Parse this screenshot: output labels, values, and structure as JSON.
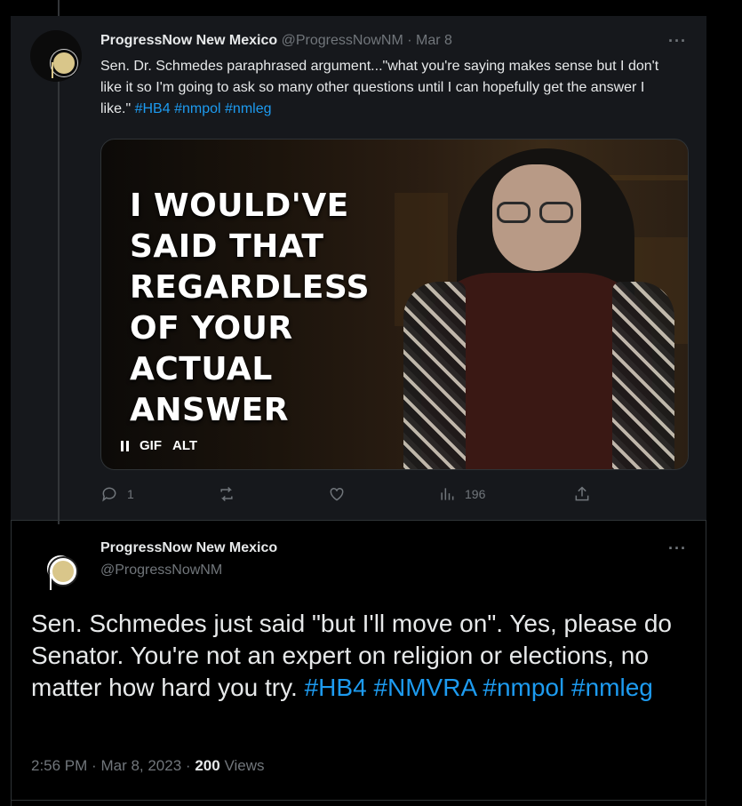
{
  "tweet1": {
    "author_name": "ProgressNow New Mexico",
    "handle": "@ProgressNowNM",
    "separator": "·",
    "date": "Mar 8",
    "more_label": "···",
    "text": "Sen. Dr. Schmedes paraphrased argument...\"what you're saying makes sense but I don't like it so I'm going to ask so many other questions until I can hopefully get the answer I like.\"",
    "hashtags": [
      "#HB4",
      "#nmpol",
      "#nmleg"
    ],
    "media": {
      "caption_lines": [
        "I WOULD'VE",
        "SAID THAT",
        "REGARDLESS",
        "OF YOUR",
        "ACTUAL",
        "ANSWER"
      ],
      "gif_label": "GIF",
      "alt_label": "ALT"
    },
    "actions": {
      "reply_count": "1",
      "retweet_count": "",
      "like_count": "",
      "views_count": "196"
    }
  },
  "tweet2": {
    "author_name": "ProgressNow New Mexico",
    "handle": "@ProgressNowNM",
    "more_label": "···",
    "text": "Sen. Schmedes just said \"but I'll move on\". Yes, please do Senator. You're not an expert on religion or elections, no matter how hard you try.",
    "hashtags": [
      "#HB4",
      "#NMVRA",
      "#nmpol",
      "#nmleg"
    ],
    "time": "2:56 PM",
    "date": "Mar 8, 2023",
    "separator": "·",
    "views_count": "200",
    "views_label": "Views"
  },
  "colors": {
    "background": "#000000",
    "thread_background": "#16181c",
    "link": "#1d9bf0",
    "muted": "#71767b",
    "text": "#e7e9ea"
  }
}
